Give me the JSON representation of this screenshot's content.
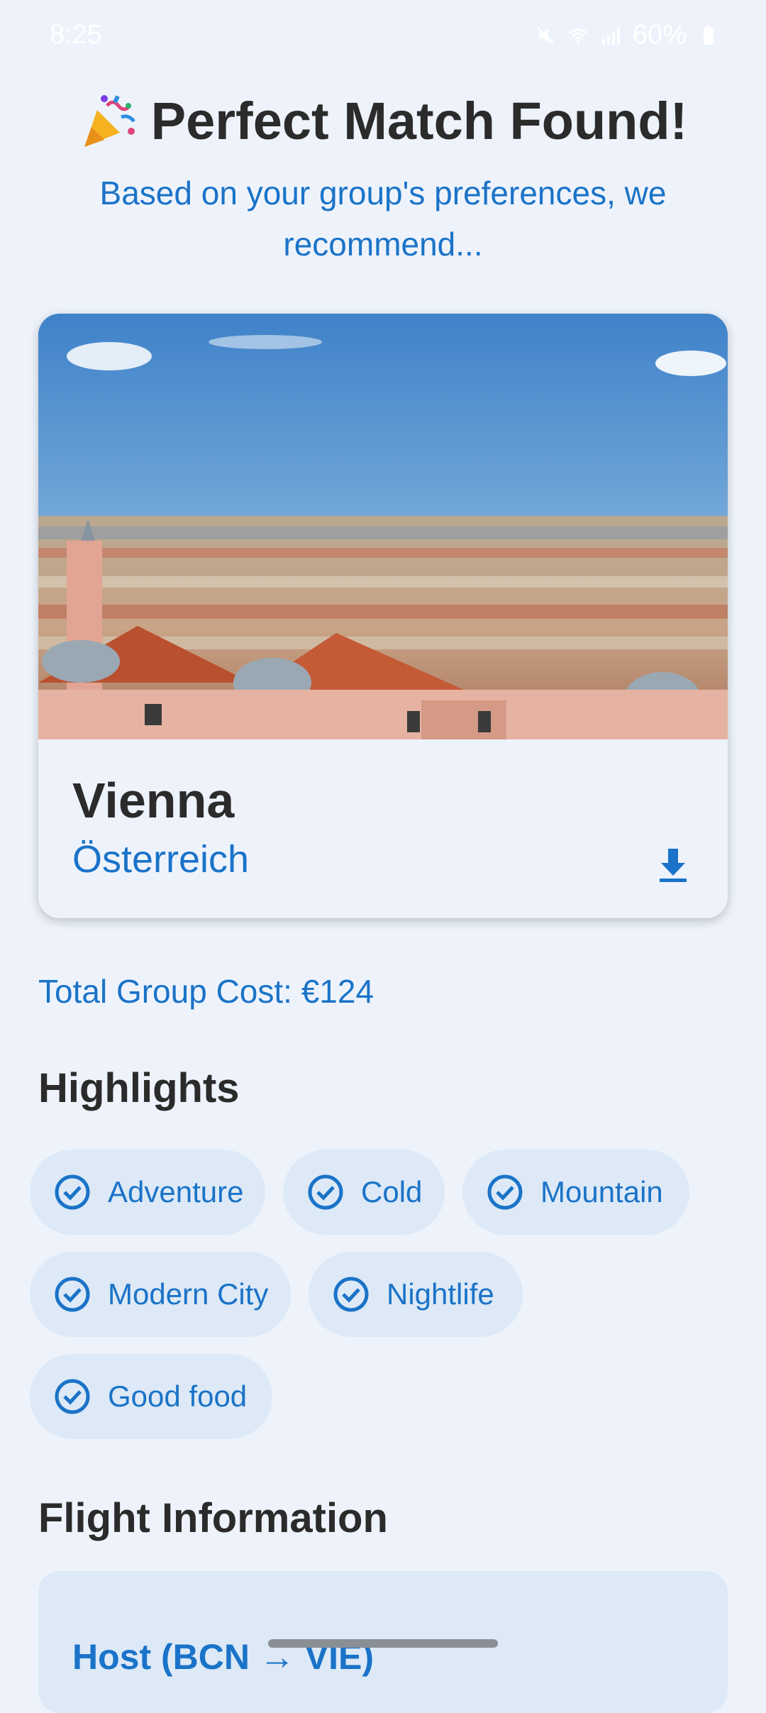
{
  "status_bar": {
    "time": "8:25",
    "battery": "60%"
  },
  "header": {
    "title": "Perfect Match Found!",
    "subtitle": "Based on your group's preferences, we recommend..."
  },
  "destination": {
    "city": "Vienna",
    "country": "Österreich"
  },
  "cost": {
    "label": "Total Group Cost: €124"
  },
  "highlights": {
    "heading": "Highlights",
    "items": [
      {
        "label": "Adventure"
      },
      {
        "label": "Cold"
      },
      {
        "label": "Mountain"
      },
      {
        "label": "Modern City"
      },
      {
        "label": "Nightlife"
      },
      {
        "label": "Good food"
      }
    ]
  },
  "flight": {
    "heading": "Flight Information",
    "route": "Host (BCN → VIE)"
  },
  "colors": {
    "accent": "#1a73c8",
    "background": "#eef3fb",
    "chip": "#dde9f6",
    "text": "#2b2b2b"
  },
  "icons": {
    "download": "download-icon",
    "check": "check-circle-icon",
    "party": "party-popper-icon"
  }
}
